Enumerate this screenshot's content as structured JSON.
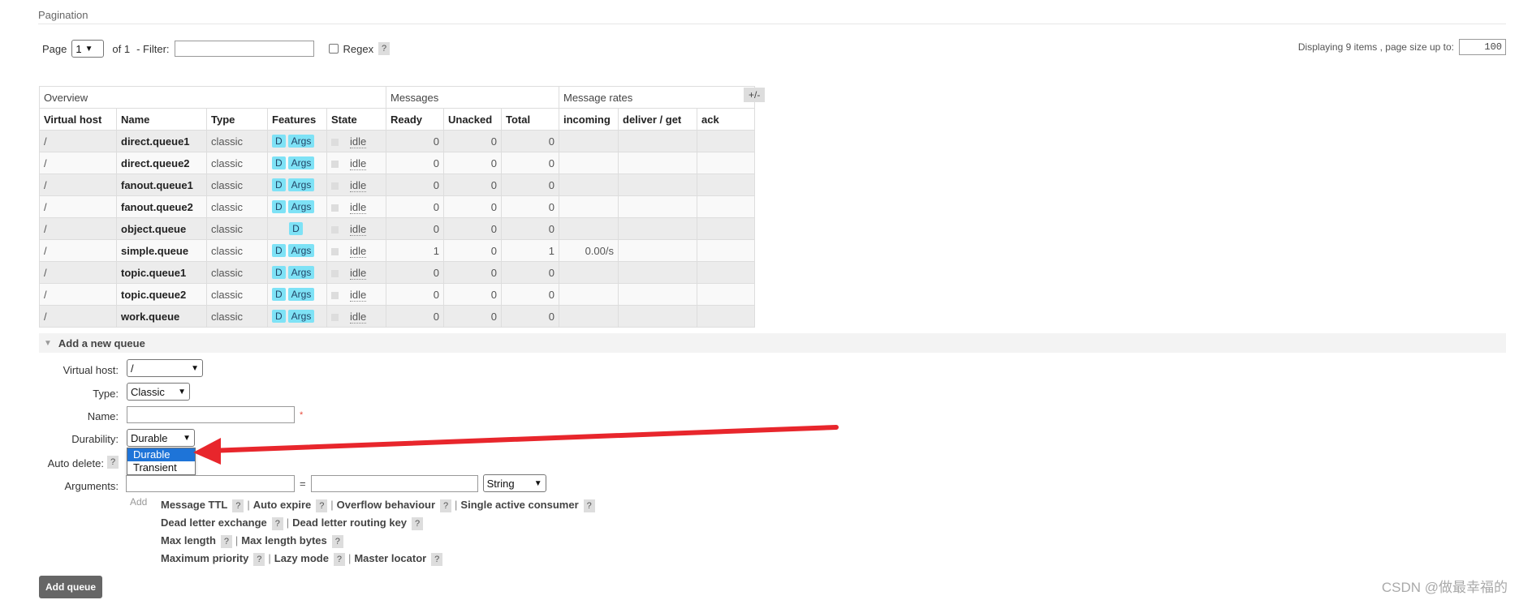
{
  "section": {
    "title": "Pagination"
  },
  "pagination": {
    "page_label": "Page",
    "page_value": "1",
    "of_label": "of 1",
    "filter_label": "- Filter:",
    "filter_value": "",
    "regex_label": "Regex",
    "help": "?",
    "display_text": "Displaying 9 items , page size up to:",
    "page_size": "100"
  },
  "table": {
    "groups": [
      "Overview",
      "Messages",
      "Message rates"
    ],
    "plus_minus": "+/-",
    "columns": [
      "Virtual host",
      "Name",
      "Type",
      "Features",
      "State",
      "Ready",
      "Unacked",
      "Total",
      "incoming",
      "deliver / get",
      "ack"
    ],
    "rows": [
      {
        "vhost": "/",
        "name": "direct.queue1",
        "type": "classic",
        "d": "D",
        "args": "Args",
        "state": "idle",
        "ready": "0",
        "unacked": "0",
        "total": "0",
        "incoming": "",
        "deliver": "",
        "ack": ""
      },
      {
        "vhost": "/",
        "name": "direct.queue2",
        "type": "classic",
        "d": "D",
        "args": "Args",
        "state": "idle",
        "ready": "0",
        "unacked": "0",
        "total": "0",
        "incoming": "",
        "deliver": "",
        "ack": ""
      },
      {
        "vhost": "/",
        "name": "fanout.queue1",
        "type": "classic",
        "d": "D",
        "args": "Args",
        "state": "idle",
        "ready": "0",
        "unacked": "0",
        "total": "0",
        "incoming": "",
        "deliver": "",
        "ack": ""
      },
      {
        "vhost": "/",
        "name": "fanout.queue2",
        "type": "classic",
        "d": "D",
        "args": "Args",
        "state": "idle",
        "ready": "0",
        "unacked": "0",
        "total": "0",
        "incoming": "",
        "deliver": "",
        "ack": ""
      },
      {
        "vhost": "/",
        "name": "object.queue",
        "type": "classic",
        "d": "D",
        "args": "",
        "state": "idle",
        "ready": "0",
        "unacked": "0",
        "total": "0",
        "incoming": "",
        "deliver": "",
        "ack": ""
      },
      {
        "vhost": "/",
        "name": "simple.queue",
        "type": "classic",
        "d": "D",
        "args": "Args",
        "state": "idle",
        "ready": "1",
        "unacked": "0",
        "total": "1",
        "incoming": "0.00/s",
        "deliver": "",
        "ack": ""
      },
      {
        "vhost": "/",
        "name": "topic.queue1",
        "type": "classic",
        "d": "D",
        "args": "Args",
        "state": "idle",
        "ready": "0",
        "unacked": "0",
        "total": "0",
        "incoming": "",
        "deliver": "",
        "ack": ""
      },
      {
        "vhost": "/",
        "name": "topic.queue2",
        "type": "classic",
        "d": "D",
        "args": "Args",
        "state": "idle",
        "ready": "0",
        "unacked": "0",
        "total": "0",
        "incoming": "",
        "deliver": "",
        "ack": ""
      },
      {
        "vhost": "/",
        "name": "work.queue",
        "type": "classic",
        "d": "D",
        "args": "Args",
        "state": "idle",
        "ready": "0",
        "unacked": "0",
        "total": "0",
        "incoming": "",
        "deliver": "",
        "ack": ""
      }
    ]
  },
  "add_queue": {
    "title": "Add a new queue",
    "vhost_label": "Virtual host:",
    "vhost_value": "/",
    "type_label": "Type:",
    "type_value": "Classic",
    "name_label": "Name:",
    "name_value": "",
    "required_mark": "*",
    "durability_label": "Durability:",
    "durability_value": "Durable",
    "durability_options": [
      "Durable",
      "Transient"
    ],
    "auto_delete_label": "Auto delete:",
    "arguments_label": "Arguments:",
    "equals": "=",
    "arg_type_value": "String",
    "add_link": "Add",
    "hints": [
      [
        "Message TTL",
        "Auto expire",
        "Overflow behaviour",
        "Single active consumer"
      ],
      [
        "Dead letter exchange",
        "Dead letter routing key"
      ],
      [
        "Max length",
        "Max length bytes"
      ],
      [
        "Maximum priority",
        "Lazy mode",
        "Master locator"
      ]
    ],
    "submit_label": "Add queue"
  },
  "watermark": "CSDN @做最幸福的",
  "colors": {
    "tag": "#7ee2f6",
    "arrow": "#e8262c",
    "selected_option": "#1e74d8",
    "button": "#666666"
  }
}
